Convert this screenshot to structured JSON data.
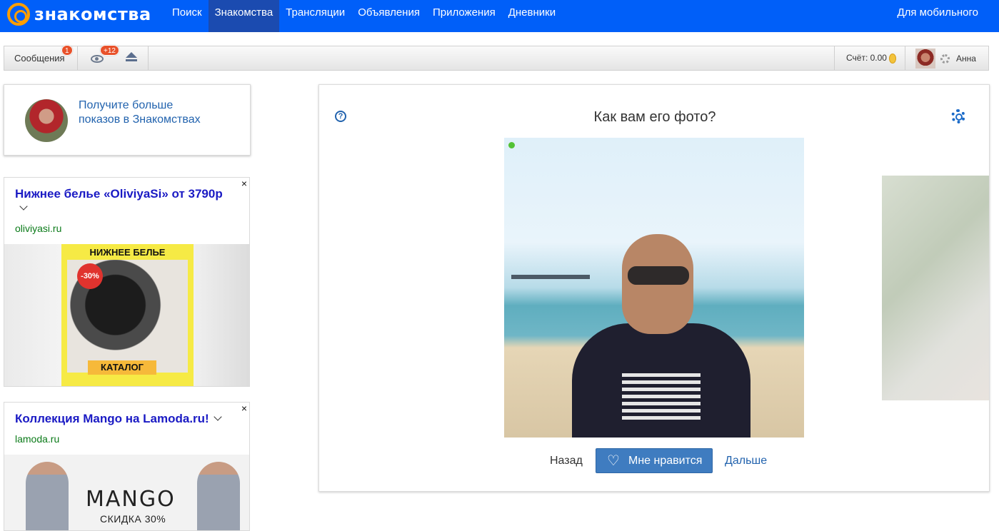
{
  "header": {
    "logo_text": "знакомства",
    "nav": [
      "Поиск",
      "Знакомства",
      "Трансляции",
      "Объявления",
      "Приложения",
      "Дневники"
    ],
    "active_index": 1,
    "mobile_link": "Для мобильного",
    "brand_color": "#005ff9"
  },
  "toolbar": {
    "messages_label": "Сообщения",
    "messages_badge": "1",
    "views_badge": "+12",
    "score_label": "Счёт: 0.00",
    "user_name": "Анна"
  },
  "promo": {
    "text": "Получите больше показов в Знакомствах"
  },
  "ads": [
    {
      "title": "Нижнее белье «OliviyaSi» от 3790р",
      "domain": "oliviyasi.ru",
      "image_header": "НИЖНЕЕ БЕЛЬЕ",
      "image_sale": "-30%",
      "image_button": "КАТАЛОГ",
      "close": "×"
    },
    {
      "title": "Коллекция Mango на Lamoda.ru!",
      "domain": "lamoda.ru",
      "image_brand": "MANGO",
      "image_sub": "СКИДКА 30%",
      "close": "×"
    }
  ],
  "main": {
    "question": "Как вам его фото?",
    "help_icon": "?",
    "back_label": "Назад",
    "like_label": "Мне нравится",
    "next_label": "Дальше",
    "accent_color": "#3f7cc0"
  }
}
